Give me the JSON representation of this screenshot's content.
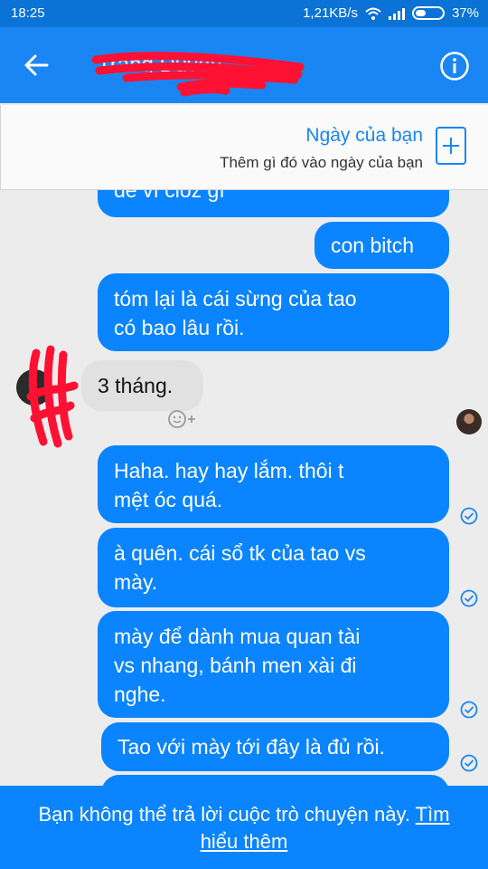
{
  "status_bar": {
    "time": "18:25",
    "network_speed": "1,21KB/s",
    "battery": "37%"
  },
  "header": {
    "contact_name": "Trang Duyên"
  },
  "day_card": {
    "title": "Ngày của bạn",
    "subtitle": "Thêm gì đó vào ngày của bạn"
  },
  "messages": {
    "m0": "để vì cloz gì",
    "m1": "con bitch",
    "m2a": "tóm lại là cái sừng của tao",
    "m2b": "có bao lâu rồi.",
    "m3": "3 tháng.",
    "m4a": "Haha. hay hay lắm. thôi t",
    "m4b": "mệt óc quá.",
    "m5a": "à quên. cái sổ tk của tao vs",
    "m5b": "mày.",
    "m6a": "mày để dành mua quan tài",
    "m6b": "vs nhang, bánh men xài đi",
    "m6c": "nghe.",
    "m7": "Tao với mày tới đây là đủ rồi."
  },
  "footer": {
    "text": "Bạn không thể trả lời cuộc trò chuyện này.",
    "link_part1": "Tìm",
    "link_part2": "hiểu thêm"
  },
  "colors": {
    "header": "#1a86f3",
    "status_bar": "#0b72d6",
    "bubble_out": "#0a84ff",
    "bubble_in": "#e1e1e1",
    "redaction": "#ff1133"
  },
  "icons": [
    "back-arrow-icon",
    "info-icon",
    "plus-icon",
    "wifi-icon",
    "signal-icon",
    "battery-icon",
    "reaction-smiley-icon",
    "seen-check-icon"
  ]
}
